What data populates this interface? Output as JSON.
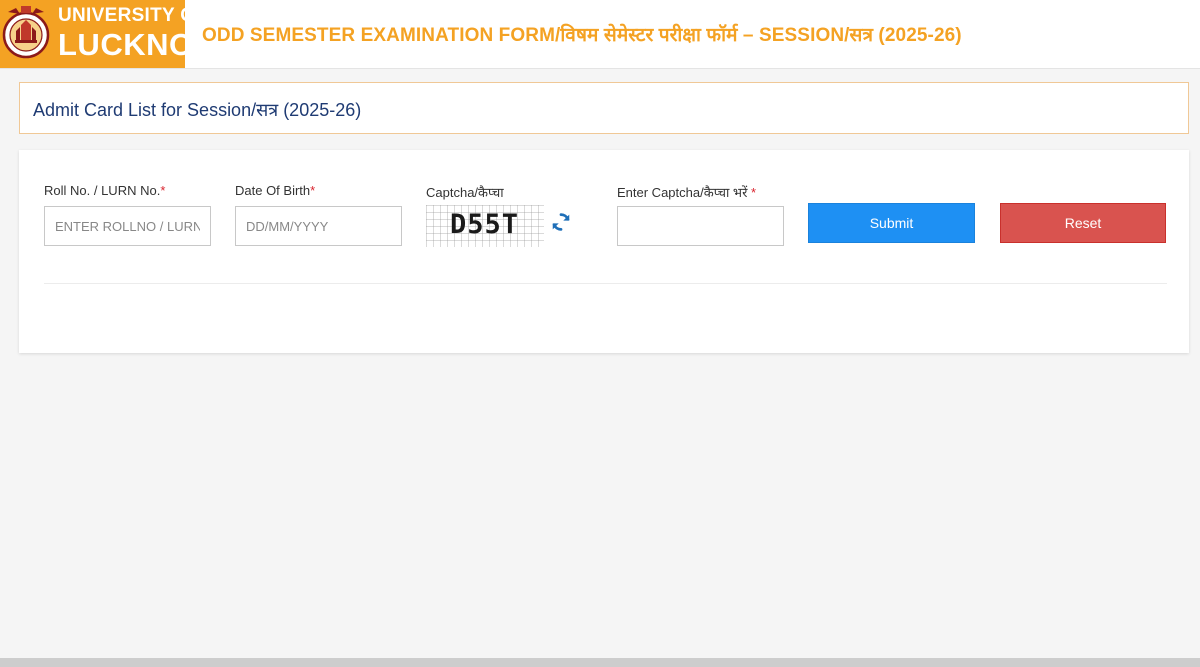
{
  "header": {
    "logo_line1": "UNIVERSITY OF",
    "logo_line2": "LUCKNOW",
    "title": "ODD SEMESTER EXAMINATION FORM/विषम सेमेस्टर परीक्षा फॉर्म – SESSION/सत्र (2025-26)"
  },
  "panel": {
    "heading": "Admit Card List for Session/सत्र (2025-26)"
  },
  "form": {
    "roll": {
      "label": "Roll No. / LURN No.",
      "required_mark": "*",
      "placeholder": "ENTER ROLLNO / LURN NO",
      "value": ""
    },
    "dob": {
      "label": "Date Of Birth",
      "required_mark": "*",
      "placeholder": "DD/MM/YYYY",
      "value": ""
    },
    "captcha": {
      "label": "Captcha/कैप्चा",
      "code": "D55T",
      "refresh_icon": "refresh-icon"
    },
    "captcha_input": {
      "label": "Enter Captcha/कैप्चा भरें",
      "required_mark": "*",
      "value": ""
    },
    "submit_label": "Submit",
    "reset_label": "Reset"
  },
  "colors": {
    "brand_orange": "#f4a223",
    "heading_navy": "#1f3b73",
    "submit_blue": "#1e90f3",
    "reset_red": "#d9534f",
    "required_red": "#d9232d"
  }
}
